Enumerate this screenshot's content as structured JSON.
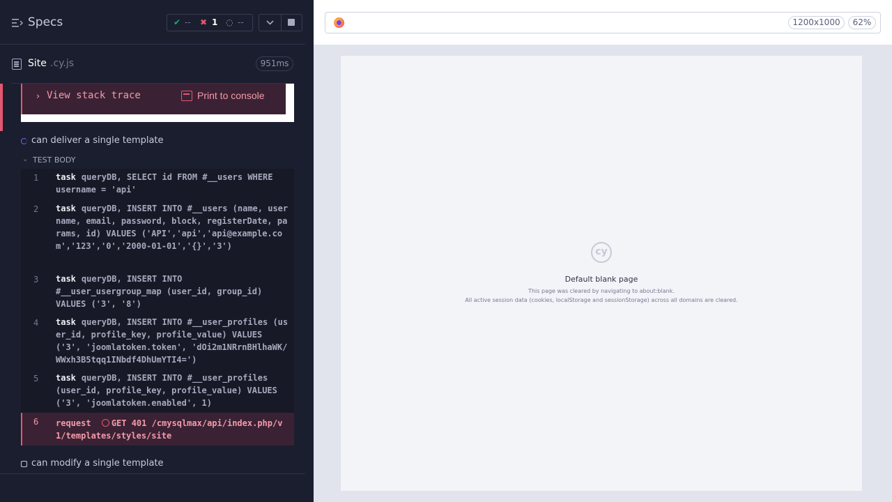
{
  "header": {
    "title": "Specs",
    "stats": {
      "passed": "--",
      "failed": "1",
      "pending": "--"
    }
  },
  "spec": {
    "name": "Site",
    "ext": ".cy.js",
    "duration": "951ms"
  },
  "error_actions": {
    "stack_trace": "View stack trace",
    "print_console": "Print to console"
  },
  "tests": [
    {
      "title": "can deliver a single template",
      "state": "running"
    },
    {
      "title": "can modify a single template",
      "state": "pending"
    }
  ],
  "hook_label": "TEST BODY",
  "commands": [
    {
      "num": "1",
      "name": "task",
      "msg": "queryDB, SELECT id FROM #__users WHERE username = 'api'"
    },
    {
      "num": "2",
      "name": "task",
      "msg": "queryDB, INSERT INTO #__users (name, username, email, password, block, registerDate, params, id) VALUES ('API','api','api@example.com','123','0','2000-01-01','{}','3')"
    },
    {
      "num": "3",
      "name": "task",
      "msg": "queryDB, INSERT INTO #__user_usergroup_map (user_id, group_id) VALUES ('3', '8')"
    },
    {
      "num": "4",
      "name": "task",
      "msg": "queryDB, INSERT INTO #__user_profiles (user_id, profile_key, profile_value) VALUES ('3', 'joomlatoken.token', 'dOi2m1NRrnBHlhaWK/WWxh3B5tqq1INbdf4DhUmYTI4=')"
    },
    {
      "num": "5",
      "name": "task",
      "msg": "queryDB, INSERT INTO #__user_profiles (user_id, profile_key, profile_value) VALUES ('3', 'joomlatoken.enabled', 1)"
    },
    {
      "num": "6",
      "name": "request",
      "msg": "GET 401 /cmysqlmax/api/index.php/v1/templates/styles/site"
    }
  ],
  "aut": {
    "viewport_size": "1200x1000",
    "zoom": "62%",
    "blank_title": "Default blank page",
    "blank_line1": "This page was cleared by navigating to about:blank.",
    "blank_line2": "All active session data (cookies, localStorage and sessionStorage) across all domains are cleared.",
    "logo_text": "cy"
  }
}
